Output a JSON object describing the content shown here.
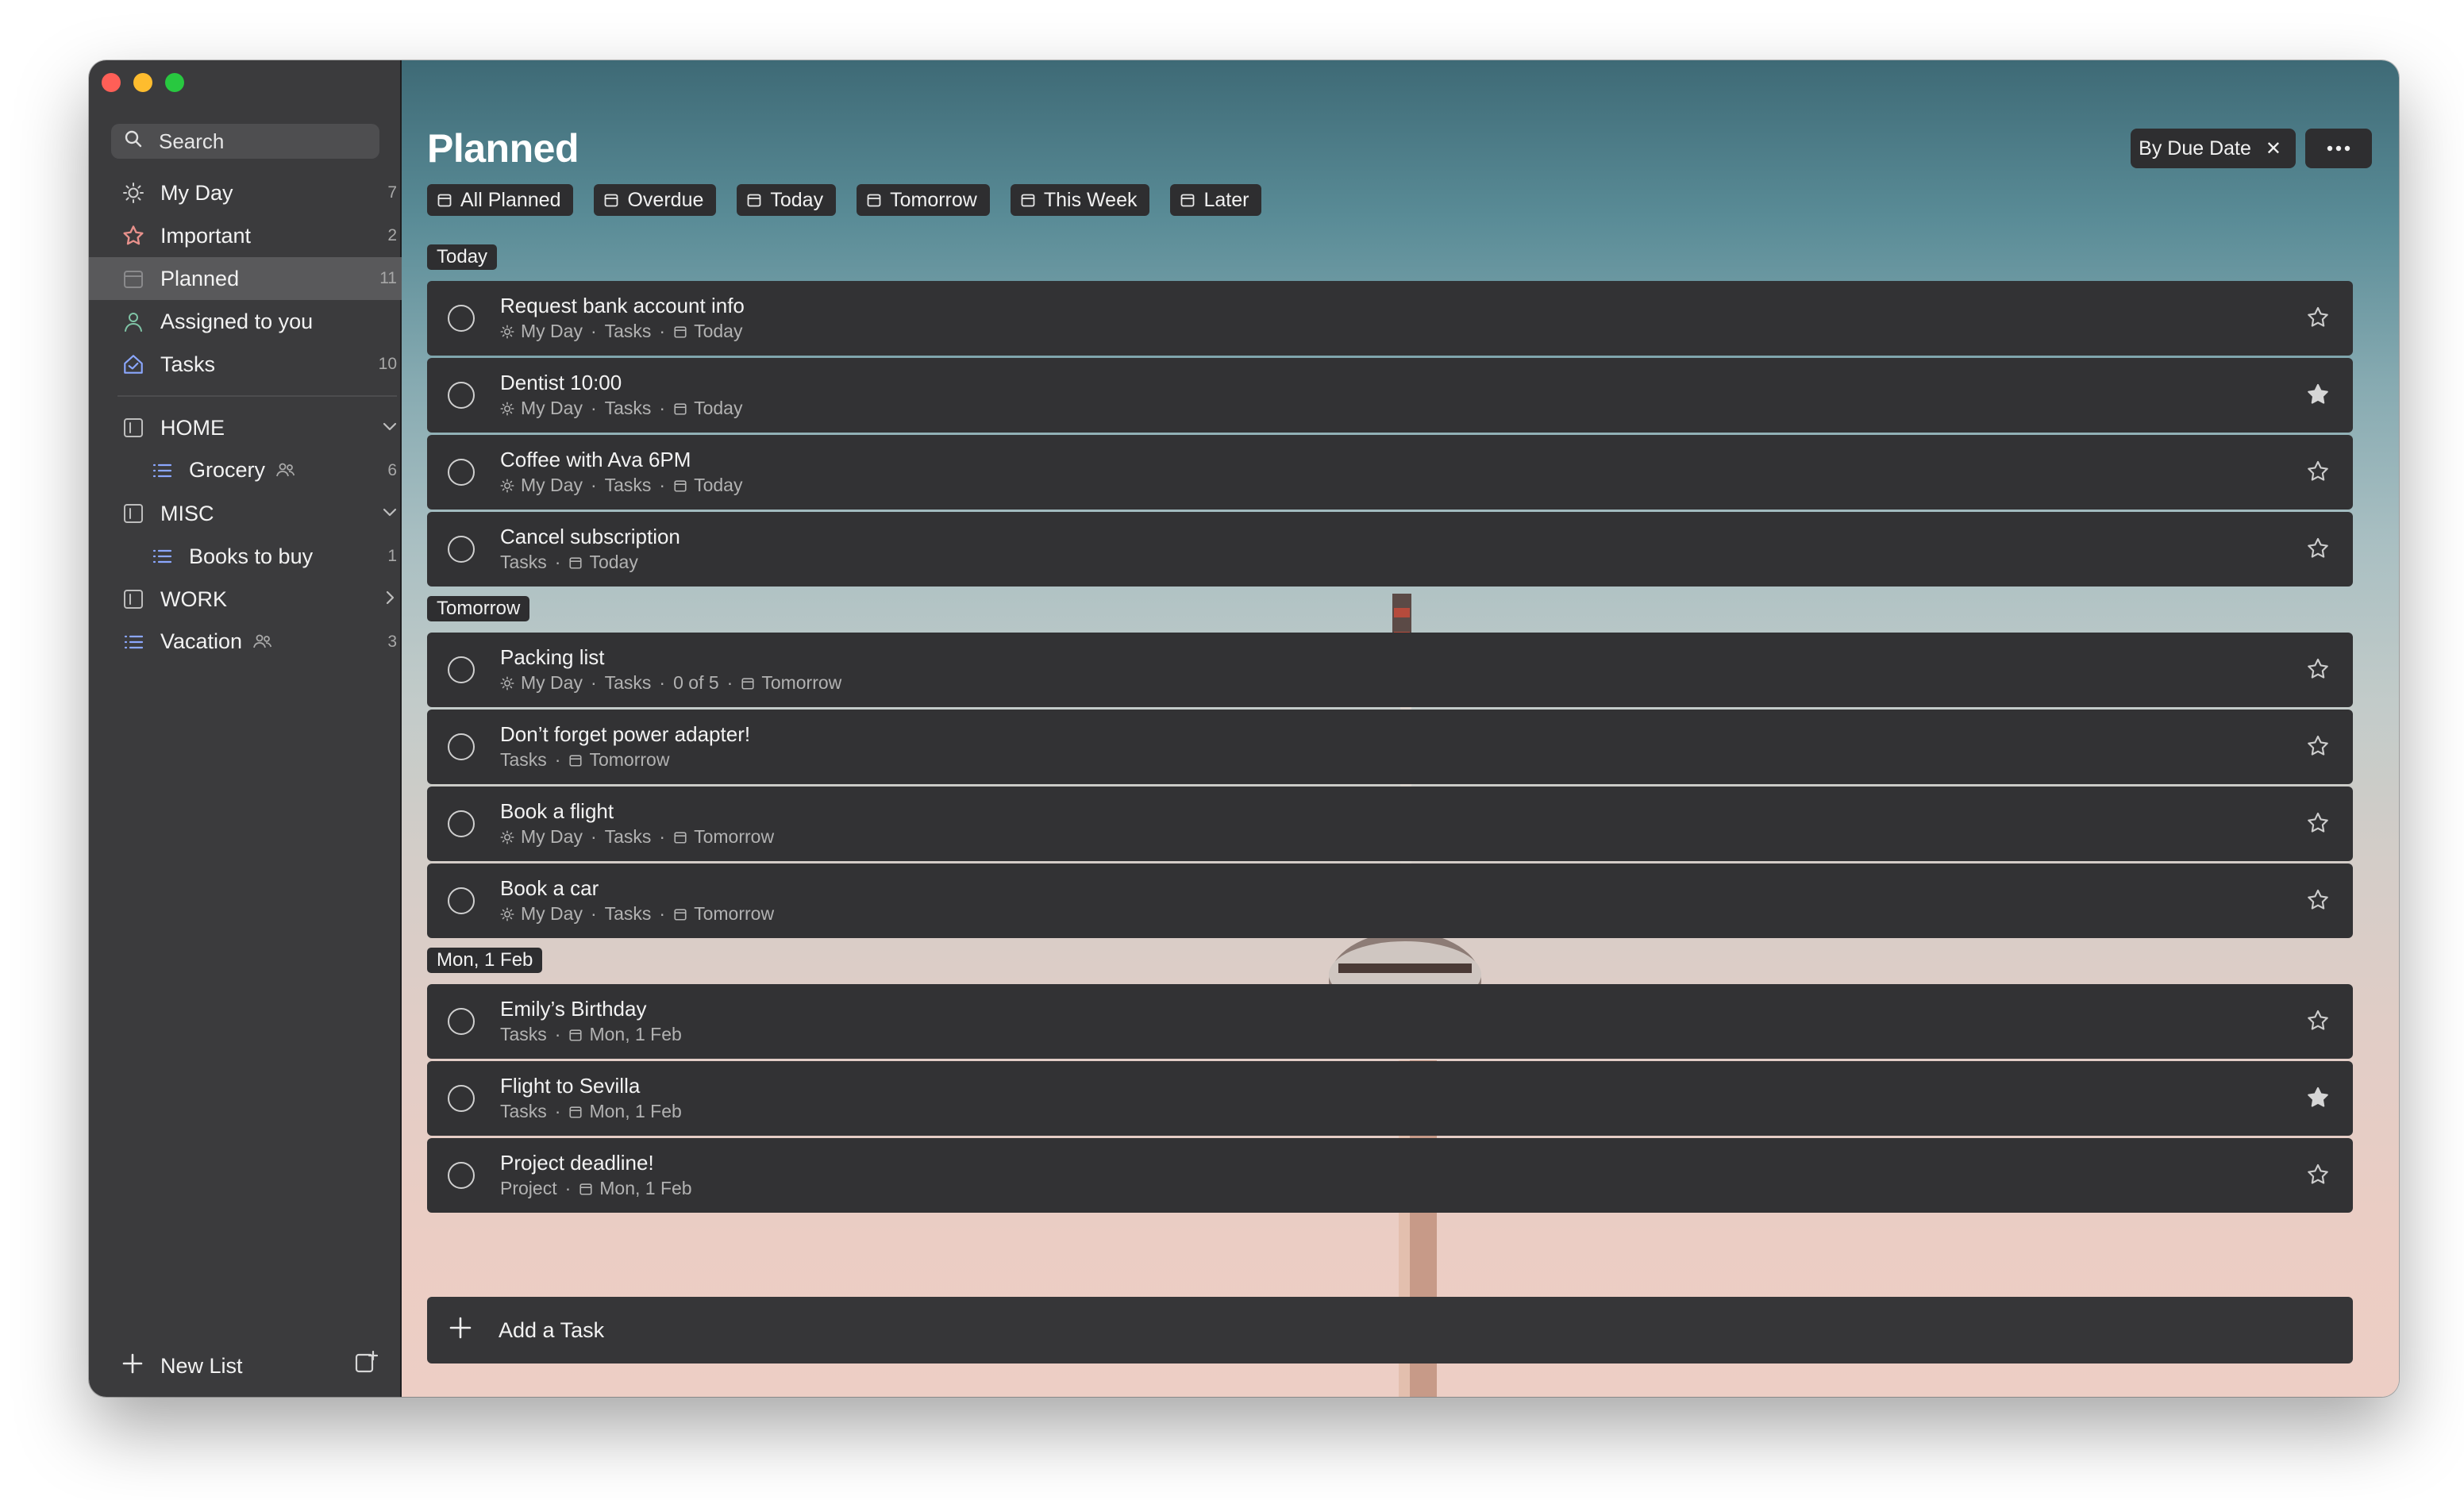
{
  "sidebar": {
    "search_placeholder": "Search",
    "smart_lists": [
      {
        "label": "My Day",
        "count": "7",
        "icon": "sun-icon"
      },
      {
        "label": "Important",
        "count": "2",
        "icon": "star-icon"
      },
      {
        "label": "Planned",
        "count": "11",
        "icon": "calendar-icon",
        "active": true
      },
      {
        "label": "Assigned to you",
        "count": "",
        "icon": "person-icon"
      },
      {
        "label": "Tasks",
        "count": "10",
        "icon": "home-icon"
      }
    ],
    "groups": [
      {
        "label": "HOME",
        "expanded": true,
        "lists": [
          {
            "label": "Grocery",
            "count": "6",
            "shared": true
          }
        ]
      },
      {
        "label": "MISC",
        "expanded": true,
        "lists": [
          {
            "label": "Books to buy",
            "count": "1",
            "shared": false
          }
        ]
      },
      {
        "label": "WORK",
        "expanded": false,
        "lists": []
      }
    ],
    "loose_lists": [
      {
        "label": "Vacation",
        "count": "3",
        "shared": true
      }
    ],
    "new_list_label": "New List"
  },
  "main": {
    "title": "Planned",
    "filters": [
      "All Planned",
      "Overdue",
      "Today",
      "Tomorrow",
      "This Week",
      "Later"
    ],
    "sort_label": "By Due Date",
    "sort_clear": "✕",
    "sections": [
      {
        "label": "Today",
        "tasks": [
          {
            "name": "Request bank account info",
            "my_day": true,
            "list": "Tasks",
            "progress": "",
            "due": "Today",
            "starred": false
          },
          {
            "name": "Dentist 10:00",
            "my_day": true,
            "list": "Tasks",
            "progress": "",
            "due": "Today",
            "starred": true
          },
          {
            "name": "Coffee with Ava 6PM",
            "my_day": true,
            "list": "Tasks",
            "progress": "",
            "due": "Today",
            "starred": false
          },
          {
            "name": "Cancel subscription",
            "my_day": false,
            "list": "Tasks",
            "progress": "",
            "due": "Today",
            "starred": false
          }
        ]
      },
      {
        "label": "Tomorrow",
        "tasks": [
          {
            "name": "Packing list",
            "my_day": true,
            "list": "Tasks",
            "progress": "0 of 5",
            "due": "Tomorrow",
            "starred": false
          },
          {
            "name": "Don’t forget power adapter!",
            "my_day": false,
            "list": "Tasks",
            "progress": "",
            "due": "Tomorrow",
            "starred": false
          },
          {
            "name": "Book a flight",
            "my_day": true,
            "list": "Tasks",
            "progress": "",
            "due": "Tomorrow",
            "starred": false
          },
          {
            "name": "Book a car",
            "my_day": true,
            "list": "Tasks",
            "progress": "",
            "due": "Tomorrow",
            "starred": false
          }
        ]
      },
      {
        "label": "Mon, 1 Feb",
        "tasks": [
          {
            "name": "Emily’s Birthday",
            "my_day": false,
            "list": "Tasks",
            "progress": "",
            "due": "Mon, 1 Feb",
            "starred": false
          },
          {
            "name": "Flight to Sevilla",
            "my_day": false,
            "list": "Tasks",
            "progress": "",
            "due": "Mon, 1 Feb",
            "starred": true
          },
          {
            "name": "Project deadline!",
            "my_day": false,
            "list": "Project",
            "progress": "",
            "due": "Mon, 1 Feb",
            "starred": false
          }
        ]
      }
    ],
    "my_day_label": "My Day",
    "add_task_label": "Add a Task"
  },
  "colors": {
    "sidebar_bg": "#3b3b3d",
    "sidebar_active": "#59595b",
    "task_bg": "#323234",
    "chip_bg": "#2e2e30",
    "text_primary": "#f3f3f3",
    "text_secondary": "#b2b2b2"
  }
}
